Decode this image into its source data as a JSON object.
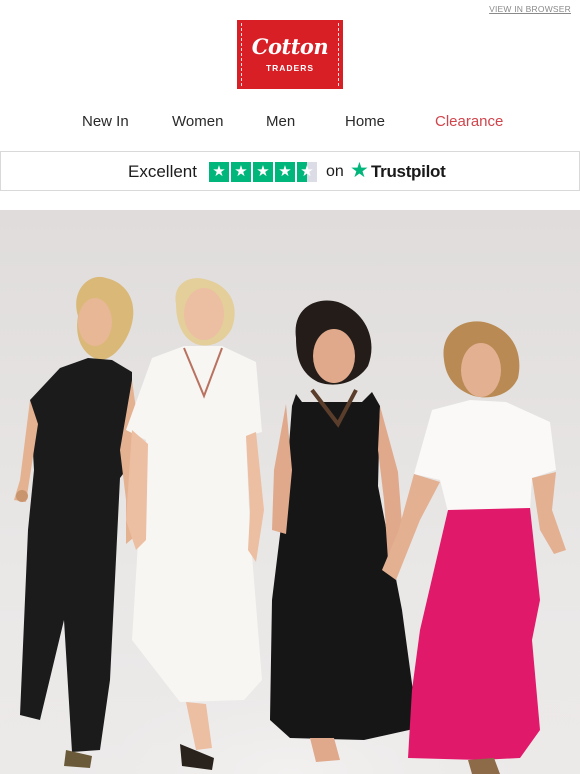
{
  "header": {
    "view_in_browser": "VIEW IN BROWSER",
    "logo": {
      "brand": "Cotton",
      "sub": "TRADERS",
      "color": "#d81f26"
    }
  },
  "nav": {
    "items": [
      {
        "label": "New In"
      },
      {
        "label": "Women"
      },
      {
        "label": "Men"
      },
      {
        "label": "Home"
      },
      {
        "label": "Clearance",
        "color": "#d0454c"
      }
    ]
  },
  "trustpilot": {
    "rating_text": "Excellent",
    "stars": 4.5,
    "on_text": "on",
    "brand": "Trustpilot",
    "star_color": "#00b67a"
  },
  "hero": {
    "image": "four-women-walking-photo",
    "outfits": [
      "black jumpsuit",
      "white maxi dress",
      "black tiered dress",
      "white top and pink skirt"
    ]
  }
}
